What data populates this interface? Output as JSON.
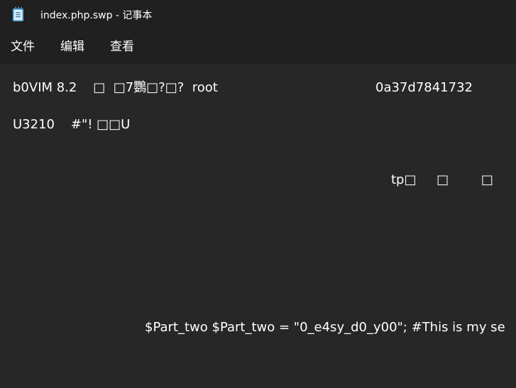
{
  "window": {
    "title": "index.php.swp - 记事本",
    "icon": "notepad-icon"
  },
  "menu": {
    "file": "文件",
    "edit": "编辑",
    "view": "查看"
  },
  "editor": {
    "line1_a": "b0VIM 8.2    □  □7鸚□?□?  root",
    "line1_b": "0a37d7841732",
    "line2": "U3210    #\"! □□U",
    "line3": "tp□     □        □",
    "line4": "$Part_two $Part_two = \"0_e4sy_d0_y00\"; #This is my se"
  }
}
